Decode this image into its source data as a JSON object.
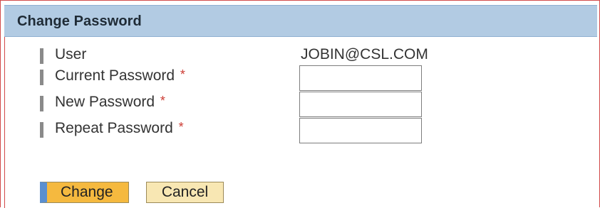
{
  "dialog": {
    "title": "Change Password"
  },
  "form": {
    "user_label": "User",
    "user_value": "JOBIN@CSL.COM",
    "current_password_label": "Current Password",
    "new_password_label": "New Password",
    "repeat_password_label": "Repeat Password",
    "required_marker": "*",
    "current_password_value": "",
    "new_password_value": "",
    "repeat_password_value": ""
  },
  "actions": {
    "change_label": "Change",
    "cancel_label": "Cancel"
  },
  "colors": {
    "title_bar": "#b2cbe3",
    "required": "#cc3b33",
    "change_button": "#f5b93f",
    "change_button_accent": "#5a8fd0",
    "cancel_button": "#f8e7b3",
    "frame_border": "#d24a4a"
  }
}
